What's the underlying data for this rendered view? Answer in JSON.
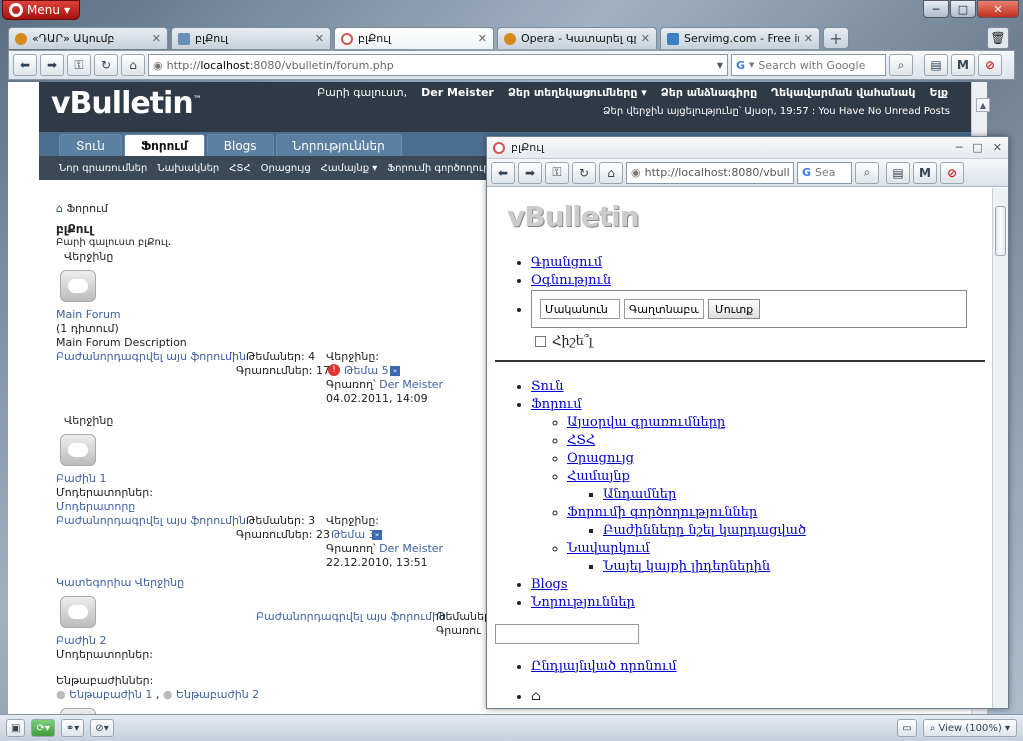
{
  "menu": {
    "label": "Menu"
  },
  "window_controls": {
    "min": "─",
    "max": "□",
    "close": "✕"
  },
  "tabs": [
    {
      "title": "«ԴԱՐ» Ակումբ",
      "close": "✕",
      "color": "#d58a1e"
    },
    {
      "title": "բլՔուլ",
      "close": "✕",
      "color": "#6c8fb8"
    },
    {
      "title": "բլՔուլ",
      "close": "✕",
      "color": "#d0584f"
    },
    {
      "title": "Opera - Կատարել գր...",
      "close": "✕",
      "color": "#d58a1e"
    },
    {
      "title": "Servimg.com - Free im...",
      "close": "✕",
      "color": "#3c7fc2"
    }
  ],
  "newtab": "+",
  "toolbar": {
    "address_prefix": "http://",
    "address_domain": "localhost",
    "address_rest": ":8080/vbulletin/forum.php",
    "search_placeholder": "Search with Google"
  },
  "header": {
    "logo": "vBulletin",
    "tm": "™",
    "greeting": "Բարի գալուստ,",
    "user": "Der Meister",
    "links": [
      "Ձեր տեղեկացումները ▾",
      "Ձեր անձնագիրը",
      "Ղեկավարման վահանակ",
      "Ելք"
    ],
    "line2": "Ձեր վերջին այցելությունը՝ Այսօր, 19:57 : You Have No Unread Posts"
  },
  "nav_tabs": [
    "Տուն",
    "Ֆորում",
    "Blogs",
    "Նորություններ"
  ],
  "sub_nav": [
    "Նոր գրառումներ",
    "Նախակներ",
    "ՀՏՀ",
    "Օրացույց",
    "Համայնք ▾",
    "Ֆորումի գործողություններ ▾"
  ],
  "content": {
    "breadcrumb": "Ֆորում",
    "title": "բլՔուլ",
    "welcome": "Բարի գալուստ բլՔուլ.",
    "last": "Վերջինը",
    "main_forum": "Main Forum",
    "viewing": "(1 դիտում)",
    "main_desc": "Main Forum Description",
    "subscribe": "Բաժանորդագրվել այս ֆորումին",
    "threads1": "Թեմաներ: 4",
    "posts1": "Գրառումներ: 17",
    "last_label": "Վերջինը:",
    "thread1": "Թեմա 5",
    "by": "Գրառող՝",
    "author": "Der Meister",
    "date1": "04.02.2011, 14:09",
    "last2": "Վերջինը",
    "section1": "Բաժին 1",
    "moderators": "Մոդերատորներ:",
    "moderators_link": "Մոդերատորը",
    "threads2": "Թեմաներ: 3",
    "posts2": "Գրառումներ: 23",
    "thread2": "Թեմա 3",
    "date2": "22.12.2010, 13:51",
    "category": "Կատեգորիա Վերջինը",
    "section2": "Բաժին 2",
    "subscribe3": "Բաժանորդագրվել այս ֆորումին",
    "threads3": "Թեմաներ",
    "posts3": "Գրառու",
    "moderators2": "Մոդերատորներ:",
    "subforums": "Ենթաբաժիններ:",
    "sub1": "Ենթաբաժին 1",
    "sep": ",",
    "sub2": "Ենթաբաժին 2"
  },
  "popup": {
    "title": "բլՔուլ",
    "address": "http://localhost:8080/vbull",
    "search": "Sea",
    "logo": "vBulletin",
    "links1": [
      "Գրանցում",
      "Օգնություն"
    ],
    "username": "Մականուն",
    "password": "Գաղտնաբառ",
    "login": "Մուտք",
    "remember": "Հիշե՞լ",
    "home": "Տուն",
    "forum": "Ֆորում",
    "forum_sub": [
      "Այսօրվա գրառումները",
      "ՀՏՀ",
      "Օրացույց",
      "Համայնք"
    ],
    "community_sub": [
      "Անդամներ"
    ],
    "forum_actions": "Ֆորումի գործողություններ",
    "forum_actions_sub": [
      "Բաժինները նշել կարդացված"
    ],
    "navigation": "Նավարկում",
    "navigation_sub": [
      "Նայել կայքի լիդերներին"
    ],
    "blogs": "Blogs",
    "news": "Նորություններ",
    "advanced": "Ընդլայնված որոնում"
  },
  "status": {
    "zoom": "View (100%)"
  }
}
